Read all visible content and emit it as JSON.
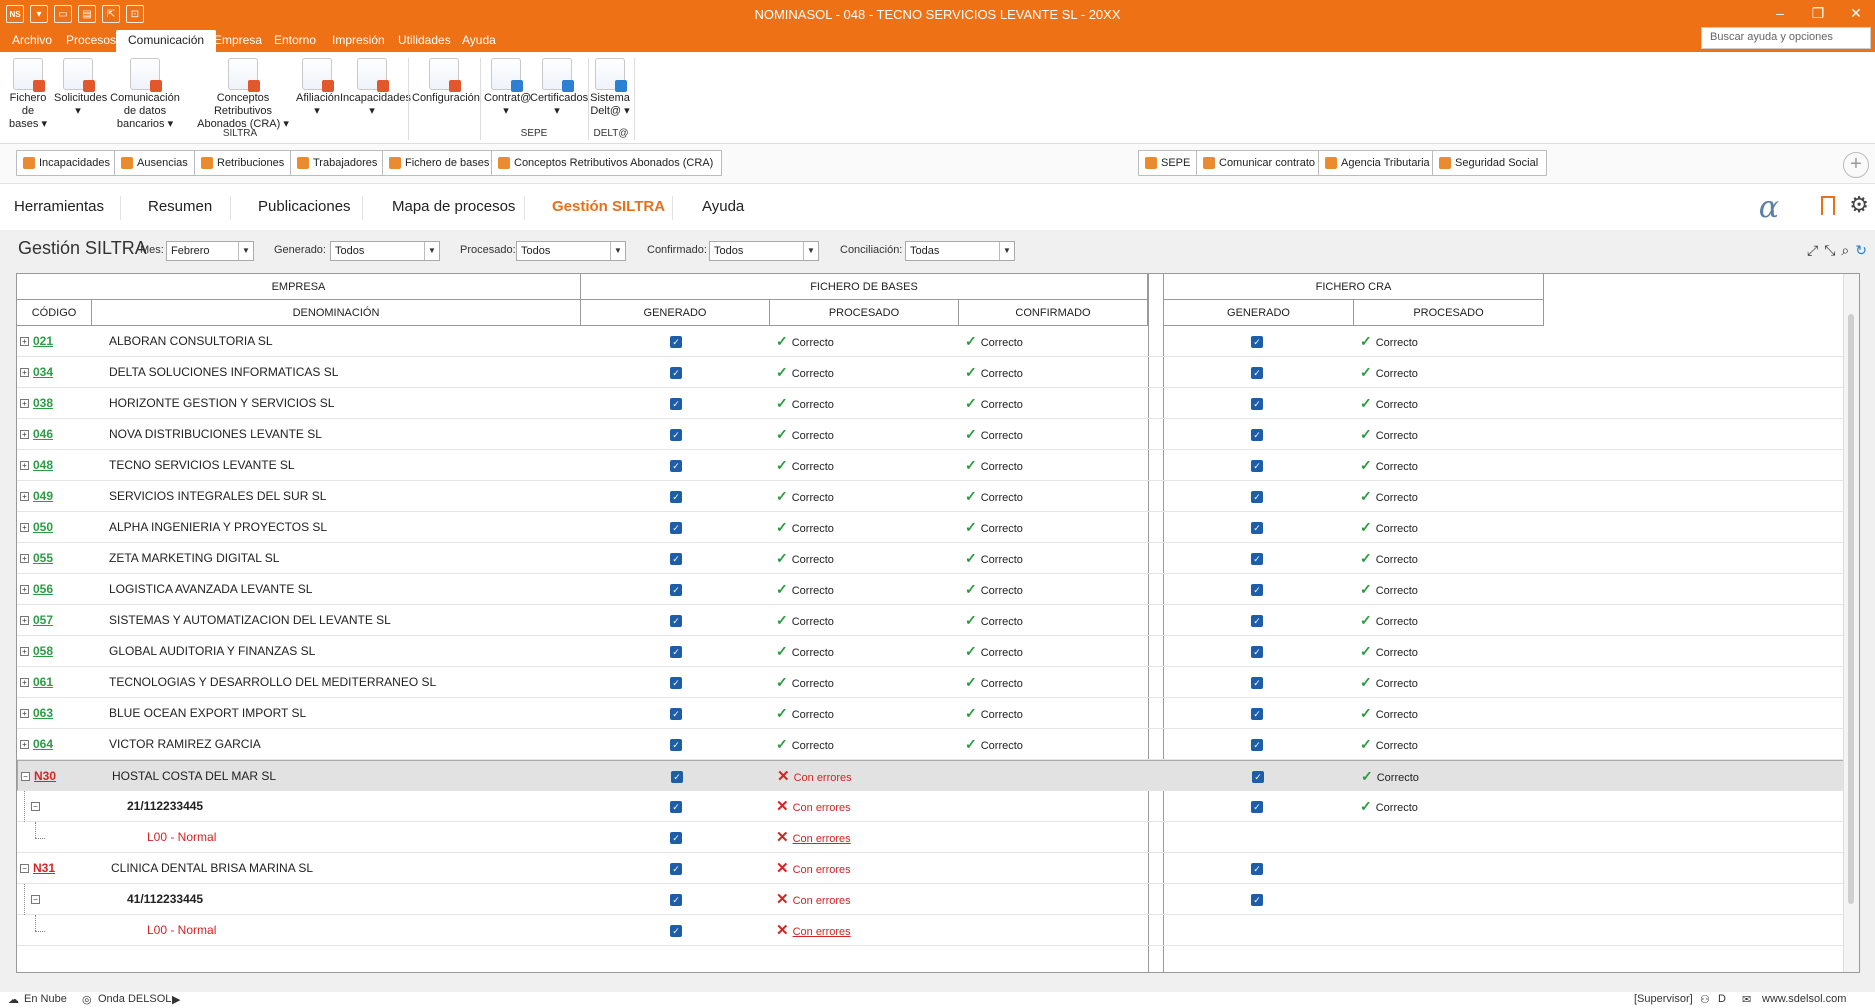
{
  "app": {
    "badge": "NS",
    "title": "NOMINASOL - 048 -  TECNO SERVICIOS LEVANTE SL - 20XX"
  },
  "menu": [
    "Archivo",
    "Procesos",
    "Comunicación",
    "Empresa",
    "Entorno",
    "Impresión",
    "Utilidades",
    "Ayuda"
  ],
  "search_placeholder": "Buscar ayuda y opciones",
  "ribbon": {
    "buttons": [
      {
        "label": "Fichero de bases",
        "icon": "file-bases-icon"
      },
      {
        "label": "Solicitudes",
        "icon": "requests-icon"
      },
      {
        "label": "Comunicación de datos bancarios",
        "icon": "bank-icon"
      },
      {
        "label": "Conceptos Retributivos Abonados (CRA)",
        "icon": "cra-icon"
      },
      {
        "label": "Afiliación",
        "icon": "affiliation-icon"
      },
      {
        "label": "Incapacidades",
        "icon": "incapacity-icon"
      },
      {
        "label": "Configuración",
        "icon": "config-icon"
      },
      {
        "label": "Contrat@",
        "icon": "contrata-icon"
      },
      {
        "label": "Certificados",
        "icon": "certificates-icon"
      },
      {
        "label": "Sistema Delt@",
        "icon": "delta-icon"
      }
    ],
    "groups": [
      "SILTRA",
      "SEPE",
      "DELT@"
    ]
  },
  "shortcuts_left": [
    "Incapacidades",
    "Ausencias",
    "Retribuciones",
    "Trabajadores",
    "Fichero de bases",
    "Conceptos Retributivos Abonados (CRA)"
  ],
  "shortcuts_right": [
    "SEPE",
    "Comunicar contrato",
    "Agencia Tributaria",
    "Seguridad Social"
  ],
  "tabs": [
    "Herramientas",
    "Resumen",
    "Publicaciones",
    "Mapa de procesos",
    "Gestión SILTRA",
    "Ayuda"
  ],
  "page_title": "Gestión SILTRA",
  "filters": [
    {
      "label": "Mes:",
      "value": "Febrero"
    },
    {
      "label": "Generado:",
      "value": "Todos"
    },
    {
      "label": "Procesado:",
      "value": "Todos"
    },
    {
      "label": "Confirmado:",
      "value": "Todos"
    },
    {
      "label": "Conciliación:",
      "value": "Todas"
    }
  ],
  "headers": {
    "empresa": "EMPRESA",
    "fichero_bases": "FICHERO DE BASES",
    "fichero_cra": "FICHERO CRA",
    "codigo": "CÓDIGO",
    "denominacion": "DENOMINACIÓN",
    "generado": "GENERADO",
    "procesado": "PROCESADO",
    "confirmado": "CONFIRMADO",
    "cra_generado": "GENERADO",
    "cra_procesado": "PROCESADO"
  },
  "rows": [
    {
      "code": "021",
      "name": "ALBORAN CONSULTORIA SL",
      "proc": "Correcto",
      "conf": "Correcto",
      "cra_proc": "Correcto"
    },
    {
      "code": "034",
      "name": "DELTA SOLUCIONES INFORMATICAS SL",
      "proc": "Correcto",
      "conf": "Correcto",
      "cra_proc": "Correcto"
    },
    {
      "code": "038",
      "name": "HORIZONTE GESTION Y SERVICIOS SL",
      "proc": "Correcto",
      "conf": "Correcto",
      "cra_proc": "Correcto"
    },
    {
      "code": "046",
      "name": "NOVA DISTRIBUCIONES LEVANTE SL",
      "proc": "Correcto",
      "conf": "Correcto",
      "cra_proc": "Correcto"
    },
    {
      "code": "048",
      "name": "TECNO SERVICIOS LEVANTE SL",
      "proc": "Correcto",
      "conf": "Correcto",
      "cra_proc": "Correcto"
    },
    {
      "code": "049",
      "name": "SERVICIOS INTEGRALES DEL SUR SL",
      "proc": "Correcto",
      "conf": "Correcto",
      "cra_proc": "Correcto"
    },
    {
      "code": "050",
      "name": "ALPHA INGENIERIA Y PROYECTOS SL",
      "proc": "Correcto",
      "conf": "Correcto",
      "cra_proc": "Correcto"
    },
    {
      "code": "055",
      "name": "ZETA MARKETING DIGITAL SL",
      "proc": "Correcto",
      "conf": "Correcto",
      "cra_proc": "Correcto"
    },
    {
      "code": "056",
      "name": "LOGISTICA AVANZADA LEVANTE SL",
      "proc": "Correcto",
      "conf": "Correcto",
      "cra_proc": "Correcto"
    },
    {
      "code": "057",
      "name": "SISTEMAS Y AUTOMATIZACION DEL LEVANTE SL",
      "proc": "Correcto",
      "conf": "Correcto",
      "cra_proc": "Correcto"
    },
    {
      "code": "058",
      "name": "GLOBAL AUDITORIA Y FINANZAS SL",
      "proc": "Correcto",
      "conf": "Correcto",
      "cra_proc": "Correcto"
    },
    {
      "code": "061",
      "name": "TECNOLOGIAS Y DESARROLLO DEL MEDITERRANEO SL",
      "proc": "Correcto",
      "conf": "Correcto",
      "cra_proc": "Correcto"
    },
    {
      "code": "063",
      "name": "BLUE OCEAN EXPORT IMPORT SL",
      "proc": "Correcto",
      "conf": "Correcto",
      "cra_proc": "Correcto"
    },
    {
      "code": "064",
      "name": "VICTOR RAMIREZ GARCIA",
      "proc": "Correcto",
      "conf": "Correcto",
      "cra_proc": "Correcto"
    }
  ],
  "detail_rows": [
    {
      "code": "N30",
      "name": "HOSTAL COSTA DEL MAR SL",
      "level": 0,
      "proc": "Con errores",
      "cra_gen": true,
      "cra_proc": "Correcto"
    },
    {
      "code": "",
      "name": "21/112233445",
      "level": 1,
      "proc": "Con errores",
      "cra_gen": true,
      "cra_proc": "Correcto"
    },
    {
      "code": "",
      "name": "L00 - Normal",
      "level": 2,
      "proc": "Con errores",
      "cra_gen": false,
      "cra_proc": ""
    },
    {
      "code": "N31",
      "name": "CLINICA DENTAL BRISA MARINA SL",
      "level": 0,
      "proc": "Con errores",
      "cra_gen": true,
      "cra_proc": ""
    },
    {
      "code": "",
      "name": "41/112233445",
      "level": 1,
      "proc": "Con errores",
      "cra_gen": true,
      "cra_proc": ""
    },
    {
      "code": "",
      "name": "L00 - Normal",
      "level": 2,
      "proc": "Con errores",
      "cra_gen": false,
      "cra_proc": ""
    }
  ],
  "status": {
    "left1": "En Nube",
    "left2": "Onda DELSOL",
    "right1": "[Supervisor]",
    "right2": "www.sdelsol.com"
  },
  "colors": {
    "accent": "#ee7116",
    "ok": "#2b9b3f",
    "error": "#d42424",
    "check": "#1e5ea8"
  }
}
